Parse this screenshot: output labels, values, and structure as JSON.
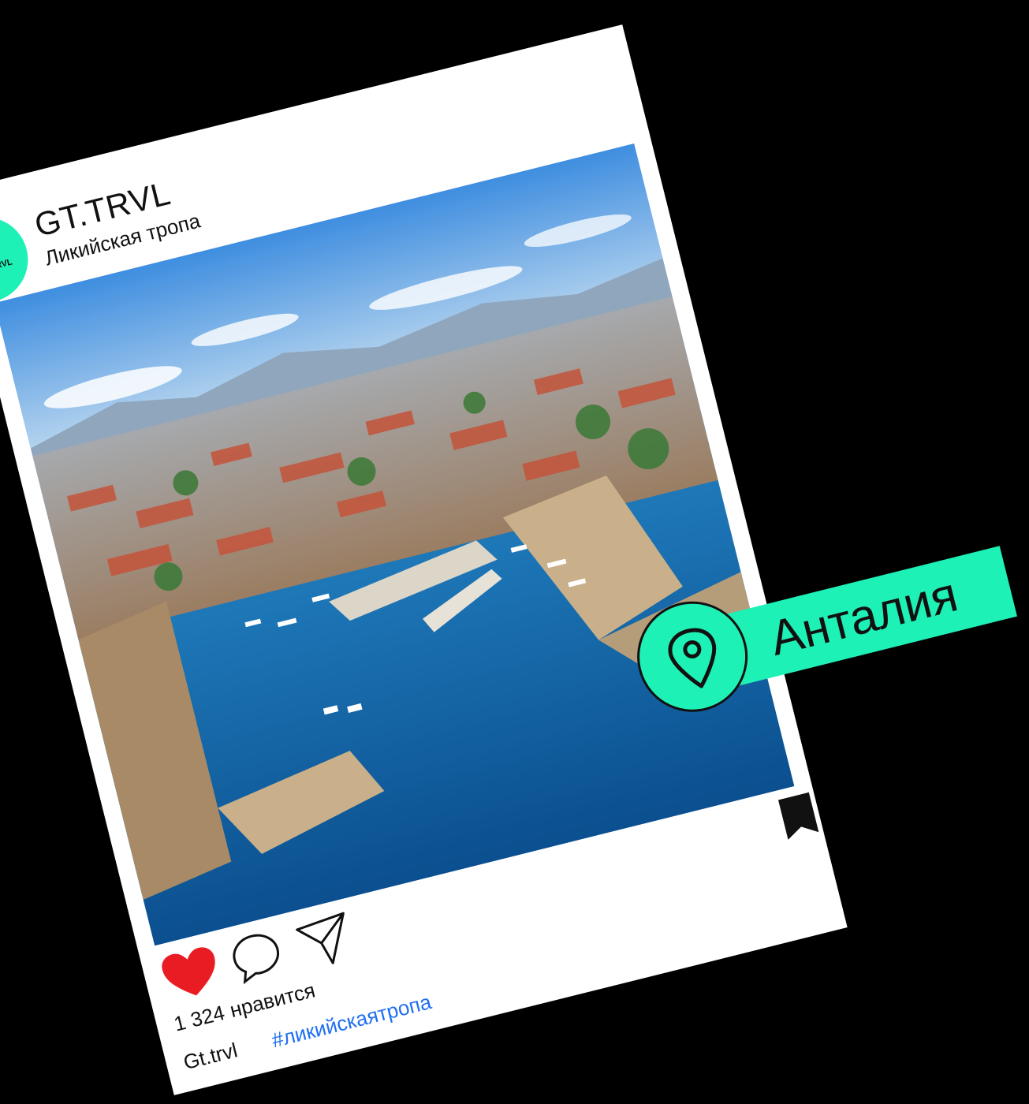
{
  "colors": {
    "accent": "#1ef1b5",
    "background": "#000000",
    "card": "#ffffff",
    "heart": "#e81c22",
    "hashtag": "#1f6ff2"
  },
  "post": {
    "account_name": "GT.TRVL",
    "account_subtitle": "Ликийская тропа",
    "logo_small_text": "TRVL",
    "photo_alt": "harbor-aerial-photo",
    "likes_count": "1 324",
    "likes_label": "нравится",
    "caption_user": "Gt.trvl",
    "caption_hashtag": "#ликийскаятропа",
    "liked": true
  },
  "location_tag": {
    "label": "Анталия",
    "icon": "location-pin-icon"
  },
  "icons": {
    "heart": "heart-icon",
    "comment": "comment-icon",
    "share": "send-icon",
    "bookmark": "bookmark-icon"
  }
}
